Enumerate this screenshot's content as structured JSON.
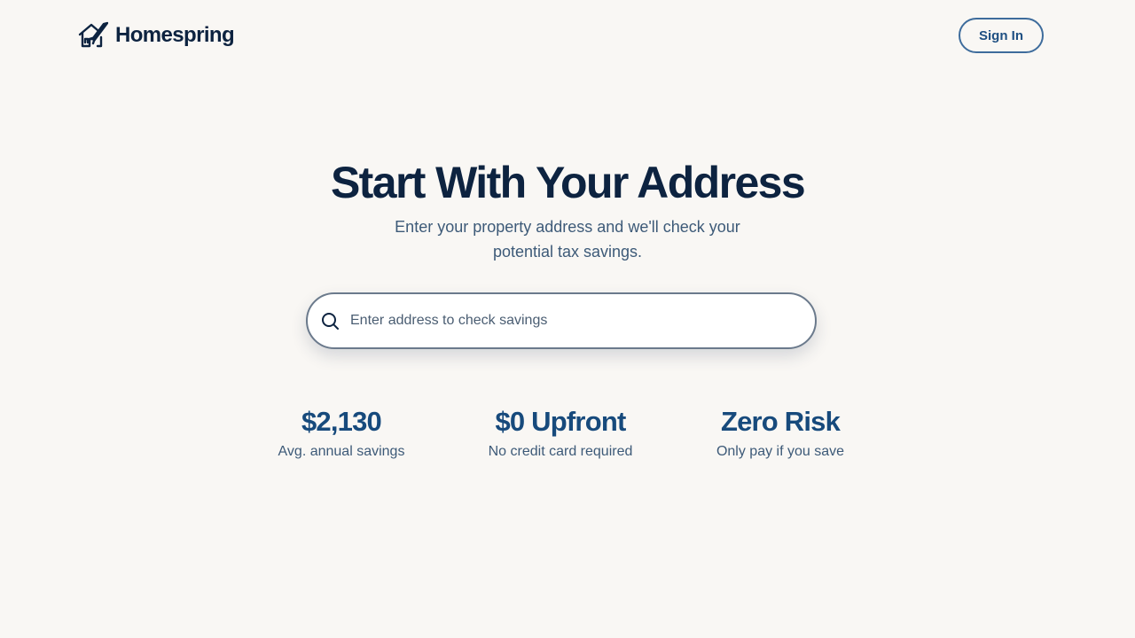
{
  "header": {
    "brand_name": "Homespring",
    "brand_logo_icon": "house-rocket-icon",
    "signin_label": "Sign In"
  },
  "hero": {
    "title": "Start With Your Address",
    "subtitle": "Enter your property address and we'll check your potential tax savings."
  },
  "search": {
    "icon": "search-icon",
    "placeholder": "Enter address to check savings",
    "value": ""
  },
  "stats": [
    {
      "value": "$2,130",
      "caption": "Avg. annual savings"
    },
    {
      "value": "$0 Upfront",
      "caption": "No credit card required"
    },
    {
      "value": "Zero Risk",
      "caption": "Only pay if you save"
    }
  ],
  "colors": {
    "background": "#f9f7f4",
    "primary_text": "#0d2340",
    "accent": "#174a7c",
    "muted_text": "#3d5a78",
    "button_border": "#3e6c9c"
  }
}
